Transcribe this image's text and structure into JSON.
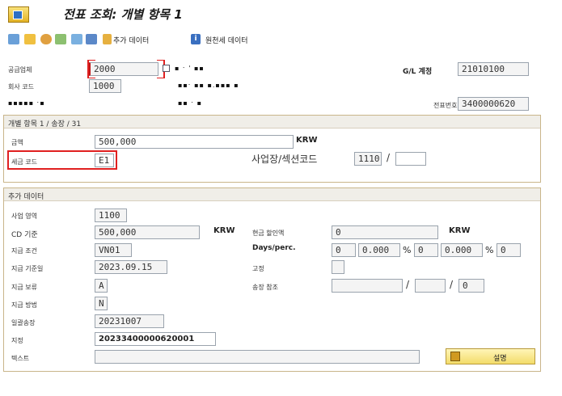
{
  "window": {
    "title": "전표 조회: 개별 항목 1"
  },
  "toolbar": {
    "additional_data": "추가 데이터",
    "original_tax_data": "원천세 데이터"
  },
  "header": {
    "vendor_label": "공급업체",
    "vendor_value": "2000",
    "vendor_name_smudged": "▪ ˑ ' ▪▪",
    "company_code_label": "회사 코드",
    "company_code_value": "1000",
    "company_name_smudged": "▪▪ˑ ▪▪ ▪.▪▪▪ ▪",
    "line3_label_smudged": "▪▪▪▪▪ ˑ▪",
    "line3_value_smudged": "▪▪ ˑ ▪",
    "gl_account_label": "G/L 계정",
    "gl_account_value": "21010100",
    "doc_no_label": "전표번호",
    "doc_no_value": "3400000620"
  },
  "item_group": {
    "title": "개별 항목 1 / 송장 / 31",
    "amount_label": "금액",
    "amount_value": "500,000",
    "amount_currency": "KRW",
    "tax_code_label": "세금 코드",
    "tax_code_value": "E1",
    "business_place_label": "사업장/섹션코드",
    "business_place_value": "1110",
    "section_code_value": ""
  },
  "extra_group": {
    "title": "추가 데이터",
    "business_area_label": "사업 영역",
    "business_area_value": "1100",
    "cd_base_label": "CD 기준",
    "cd_base_value": "500,000",
    "cd_base_currency": "KRW",
    "cash_discount_label": "현금 할인액",
    "cash_discount_value": "0",
    "cash_discount_currency": "KRW",
    "payment_terms_label": "지급 조건",
    "payment_terms_value": "VN01",
    "days_perc_label": "Days/perc.",
    "days1": "0",
    "perc1": "0.000",
    "days2": "0",
    "perc2": "0.000",
    "days3": "0",
    "pct_sign": "%",
    "baseline_date_label": "지급 기준일",
    "baseline_date_value": "2023.09.15",
    "fixed_label": "고정",
    "fixed_value": "",
    "payment_block_label": "지급 보류",
    "payment_block_value": "A",
    "invoice_ref_label": "송장 참조",
    "invoice_ref_value1": "",
    "invoice_ref_value2": "",
    "invoice_ref_value3": "0",
    "payment_method_label": "지급 방법",
    "payment_method_value": "N",
    "batch_invoice_label": "일괄송장",
    "batch_invoice_value": "20231007",
    "assignment_label": "지정",
    "assignment_value": "20233400000620001",
    "text_label": "텍스트",
    "text_value": "",
    "explain_button": "설명"
  },
  "colors": {
    "highlight": "#e02020",
    "group_border": "#c9b58a",
    "button": "#f3dc6a"
  }
}
